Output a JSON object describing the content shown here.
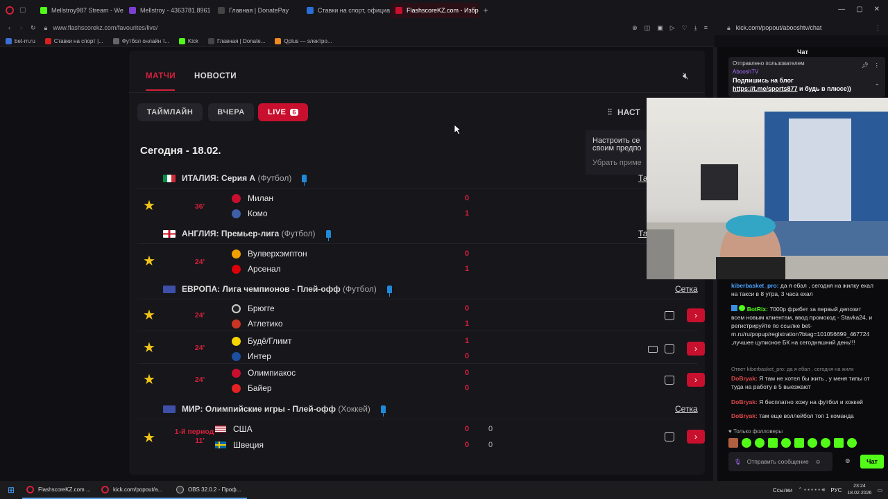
{
  "browser": {
    "tabs": [
      "Mellstroy987 Stream - We",
      "Mellstroy - 4363781.8961",
      "Главная | DonatePay",
      "Ставки на спорт, официа",
      "FlashscoreKZ.com - Избр"
    ],
    "url": "www.flashscorekz.com/favourites/live/",
    "popup_url": "kick.com/popout/abooshtv/chat",
    "bookmarks": [
      "bet-m.ru",
      "Ставки на спорт |...",
      "Футбол онлайн т...",
      "Kick",
      "Главная | Donate...",
      "Qplus — электро..."
    ]
  },
  "panel": {
    "tab_matches": "МАТЧИ",
    "tab_news": "НОВОСТИ",
    "pill_timeline": "ТАЙМЛАЙН",
    "pill_yesterday": "ВЧЕРА",
    "pill_live": "LIVE",
    "live_count": "6",
    "settings_label": "НАСТ",
    "date": "Сегодня - 18.02.",
    "tooltip_line1": "Настроить се",
    "tooltip_line2": "своим предпо",
    "tooltip_action": "Убрать приме"
  },
  "leagues": [
    {
      "country": "ИТАЛИЯ:",
      "name": "Серия А",
      "sport": "(Футбол)",
      "right": "Та"
    },
    {
      "country": "АНГЛИЯ:",
      "name": "Премьер-лига",
      "sport": "(Футбол)",
      "right": "Та"
    },
    {
      "country": "ЕВРОПА:",
      "name": "Лига чемпионов - Плей-офф",
      "sport": "(Футбол)",
      "right": "Сетка"
    },
    {
      "country": "МИР:",
      "name": "Олимпийские игры - Плей-офф",
      "sport": "(Хоккей)",
      "right": "Сетка"
    }
  ],
  "matches": [
    {
      "time": "36'",
      "home": "Милан",
      "away": "Комо",
      "hs": "0",
      "as": "1"
    },
    {
      "time": "24'",
      "home": "Вулверхэмптон",
      "away": "Арсенал",
      "hs": "0",
      "as": "1"
    },
    {
      "time": "24'",
      "home": "Брюгге",
      "away": "Атлетико",
      "hs": "0",
      "as": "1"
    },
    {
      "time": "24'",
      "home": "Будё/Глимт",
      "away": "Интер",
      "hs": "1",
      "as": "0"
    },
    {
      "time": "24'",
      "home": "Олимпиакос",
      "away": "Байер",
      "hs": "0",
      "as": "0"
    },
    {
      "time": "1-й период",
      "time2": "11'",
      "home": "США",
      "away": "Швеция",
      "hs": "0",
      "as": "0",
      "hp": "0",
      "ap": "0"
    }
  ],
  "chat": {
    "title": "Чат",
    "pinned_by": "Отправлено пользователем",
    "pinned_user": "AbooshTV",
    "pinned_text": "Подпишись на блог",
    "pinned_link": "https://t.me/sports877",
    "pinned_tail": "и будь в плюсе))",
    "messages": [
      {
        "user": "kiberbasket_pro:",
        "text": "да я ебал , сегодня на жилку ехал на такси в 8 утра, 3 часа ехал"
      },
      {
        "user": "BotRix:",
        "text": "7000р фрибет за первый депозит всем новым клиентам, ввод промокод - Stavka24, и регистрируйте по ссылке bet-m.ru/ru/popup/registration?btag=101056699_467724 ,лучшее цуписное БК на сегодняшний день!!!"
      },
      {
        "reply": "Ответ kiberbasket_pro: да я ебал , сегодня на жилк",
        "user": "DoBryak:",
        "text": "Я там не хотел бы жить , у меня типы от туда на работу в 5 выезжают"
      },
      {
        "user": "DoBryak:",
        "text": "Я бесплатно хожу на футбол и хоккей"
      },
      {
        "user": "DoBryak:",
        "text": "там еще воллейбол топ 1 команда"
      }
    ],
    "followers_only": "Только фолловеры",
    "input_placeholder": "Отправить сообщение",
    "send_label": "Чат"
  },
  "taskbar": {
    "items": [
      "FlashscoreKZ.com ...",
      "kick.com/popout/a...",
      "OBS 32.0.2 - Проф..."
    ],
    "links": "Ссылки",
    "lang": "РУС",
    "time": "23:24",
    "date": "18.02.2026"
  }
}
